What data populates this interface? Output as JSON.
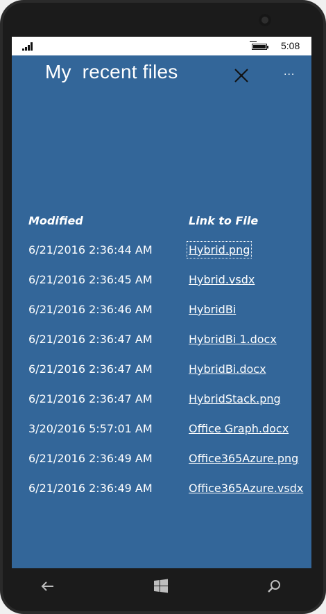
{
  "status_bar": {
    "time": "5:08"
  },
  "header": {
    "title": "My  recent files",
    "close_icon": "close-icon",
    "more_icon": "more-icon",
    "more_label": "···"
  },
  "table": {
    "columns": [
      "Modified",
      "Link to File"
    ],
    "rows": [
      {
        "modified": "6/21/2016 2:36:44 AM",
        "file": "Hybrid.png"
      },
      {
        "modified": "6/21/2016 2:36:45 AM",
        "file": "Hybrid.vsdx"
      },
      {
        "modified": "6/21/2016 2:36:46 AM",
        "file": "HybridBi"
      },
      {
        "modified": "6/21/2016 2:36:47 AM",
        "file": "HybridBi 1.docx"
      },
      {
        "modified": "6/21/2016 2:36:47 AM",
        "file": "HybridBi.docx"
      },
      {
        "modified": "6/21/2016 2:36:47 AM",
        "file": "HybridStack.png"
      },
      {
        "modified": "3/20/2016 5:57:01 AM",
        "file": "Office Graph.docx"
      },
      {
        "modified": "6/21/2016 2:36:49 AM",
        "file": "Office365Azure.png"
      },
      {
        "modified": "6/21/2016 2:36:49 AM",
        "file": "Office365Azure.vsdx"
      }
    ]
  },
  "nav_bar": {
    "back_icon": "back-arrow-icon",
    "home_icon": "windows-logo-icon",
    "search_icon": "search-icon"
  },
  "colors": {
    "screen_bg": "#336699",
    "text": "#ffffff",
    "phone_frame": "#1b1b1b"
  }
}
